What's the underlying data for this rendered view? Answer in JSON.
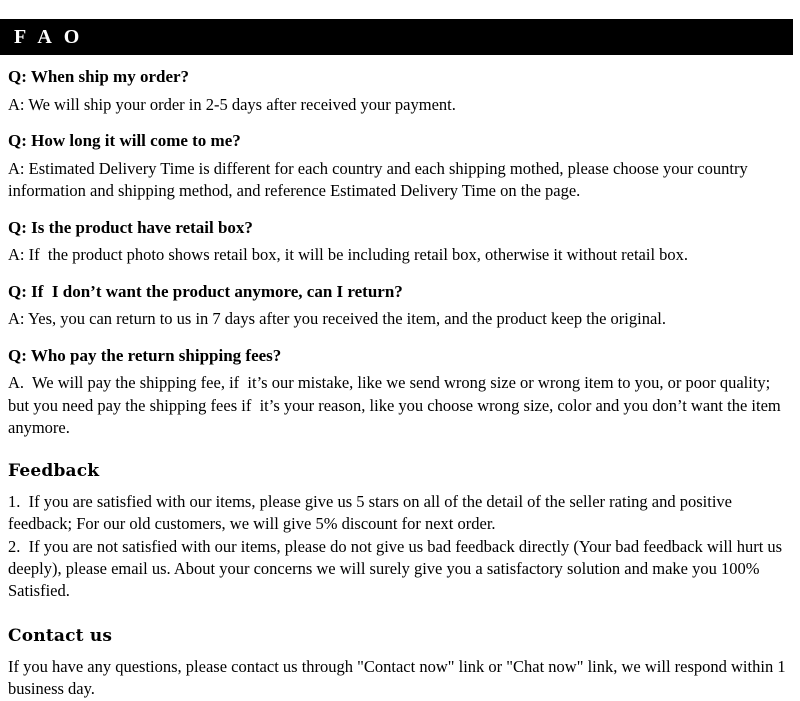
{
  "header": {
    "title": "F A O",
    "background_color": "#000000",
    "text_color": "#ffffff"
  },
  "faq": {
    "items": [
      {
        "question": "Q: When ship my order?",
        "answer": "A: We will ship your order in 2-5 days after received your payment."
      },
      {
        "question": "Q: How long it will come to me?",
        "answer": "A: Estimated Delivery Time is different for each country and each shipping mothed, please choose your country information and shipping method, and reference Estimated Delivery Time on the page."
      },
      {
        "question": "Q: Is the product have retail box?",
        "answer": "A: If  the product photo shows retail box, it will be including retail box, otherwise it without retail box."
      },
      {
        "question": "Q: If  I don’t want the product anymore, can I return?",
        "answer": "A: Yes, you can return to us in 7 days after you received the item, and the product keep the original."
      },
      {
        "question": "Q: Who pay the return shipping fees?",
        "answer": "A.  We will pay the shipping fee, if  it’s our mistake, like we send wrong size or wrong item to you, or poor quality; but you need pay the shipping fees if  it’s your reason, like you choose wrong size, color and you don’t want the item anymore."
      }
    ]
  },
  "feedback": {
    "heading": "Feedback",
    "item_1": "1.  If you are satisfied with our items, please give us 5 stars on all of the detail of the seller rating and positive feedback; For our old customers, we will give 5% discount for next order.",
    "item_2": "2.  If you are not satisfied with our items, please do not give us bad feedback directly (Your bad feedback will hurt us deeply), please email us. About your concerns we will surely give you a satisfactory solution and make you 100% Satisfied."
  },
  "contact": {
    "heading": "Contact us",
    "body": "If you have any questions, please contact us through \"Contact now\" link or \"Chat now\" link, we will respond within 1 business day."
  }
}
